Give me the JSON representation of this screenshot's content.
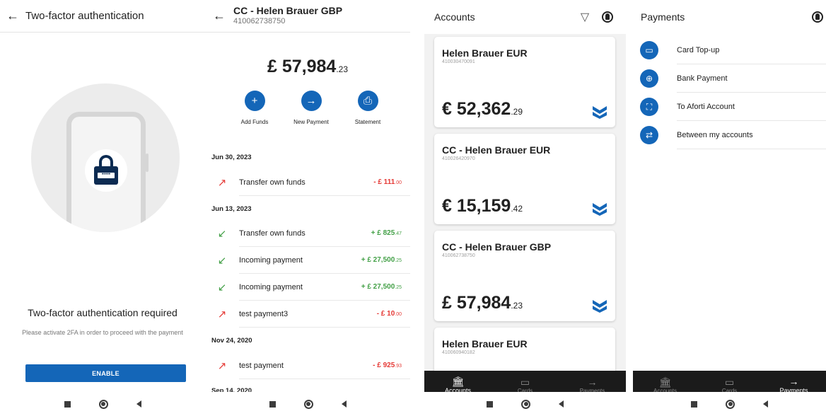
{
  "twofa": {
    "title": "Two-factor authentication",
    "heading": "Two-factor authentication required",
    "message": "Please activate 2FA in order to proceed with the payment",
    "enable_label": "ENABLE",
    "lock_dots": "•••••"
  },
  "account": {
    "title": "CC - Helen Brauer GBP",
    "number": "410062738750",
    "balance_main": "£ 57,984",
    "balance_dec": ".23",
    "actions": [
      {
        "label": "Add Funds",
        "icon": "plus-icon",
        "glyph": "+"
      },
      {
        "label": "New Payment",
        "icon": "double-arrow-icon",
        "glyph": "→"
      },
      {
        "label": "Statement",
        "icon": "statement-icon",
        "glyph": "⎙"
      }
    ],
    "dates": [
      "Jun 30, 2023",
      "Jun 13, 2023",
      "Nov 24, 2020",
      "Sep 14, 2020"
    ],
    "transactions": [
      {
        "name": "Transfer own funds",
        "amount": "- £ 111",
        "dec": ".00",
        "direction": "out"
      },
      {
        "name": "Transfer own funds",
        "amount": "+ £ 825",
        "dec": ".47",
        "direction": "in"
      },
      {
        "name": "Incoming payment",
        "amount": "+ £ 27,500",
        "dec": ".25",
        "direction": "in"
      },
      {
        "name": "Incoming payment",
        "amount": "+ £ 27,500",
        "dec": ".25",
        "direction": "in"
      },
      {
        "name": "test payment3",
        "amount": "- £ 10",
        "dec": ".00",
        "direction": "out"
      },
      {
        "name": "test payment",
        "amount": "- £ 925",
        "dec": ".93",
        "direction": "out"
      }
    ]
  },
  "accounts": {
    "title": "Accounts",
    "cards": [
      {
        "name": "Helen Brauer EUR",
        "number": "410030470091",
        "balance": "€ 52,362",
        "dec": ".29"
      },
      {
        "name": "CC - Helen Brauer EUR",
        "number": "410026420970",
        "balance": "€ 15,159",
        "dec": ".42"
      },
      {
        "name": "CC - Helen Brauer GBP",
        "number": "410062738750",
        "balance": "£ 57,984",
        "dec": ".23"
      },
      {
        "name": "Helen Brauer EUR",
        "number": "410060940182",
        "balance": "",
        "dec": ""
      }
    ]
  },
  "payments": {
    "title": "Payments",
    "items": [
      {
        "label": "Card Top-up",
        "icon": "card-topup-icon",
        "glyph": "▭"
      },
      {
        "label": "Bank Payment",
        "icon": "globe-icon",
        "glyph": "⊕"
      },
      {
        "label": "To Aforti Account",
        "icon": "user-transfer-icon",
        "glyph": "⛶"
      },
      {
        "label": "Between my accounts",
        "icon": "exchange-icon",
        "glyph": "⇄"
      }
    ]
  },
  "tabs": [
    {
      "label": "Accounts",
      "glyph": "🏛"
    },
    {
      "label": "Cards",
      "glyph": "▭"
    },
    {
      "label": "Payments",
      "glyph": "→"
    }
  ],
  "colors": {
    "primary": "#1466b8",
    "negative": "#e53935",
    "positive": "#43a047",
    "tabbar": "#1b1b1b"
  }
}
